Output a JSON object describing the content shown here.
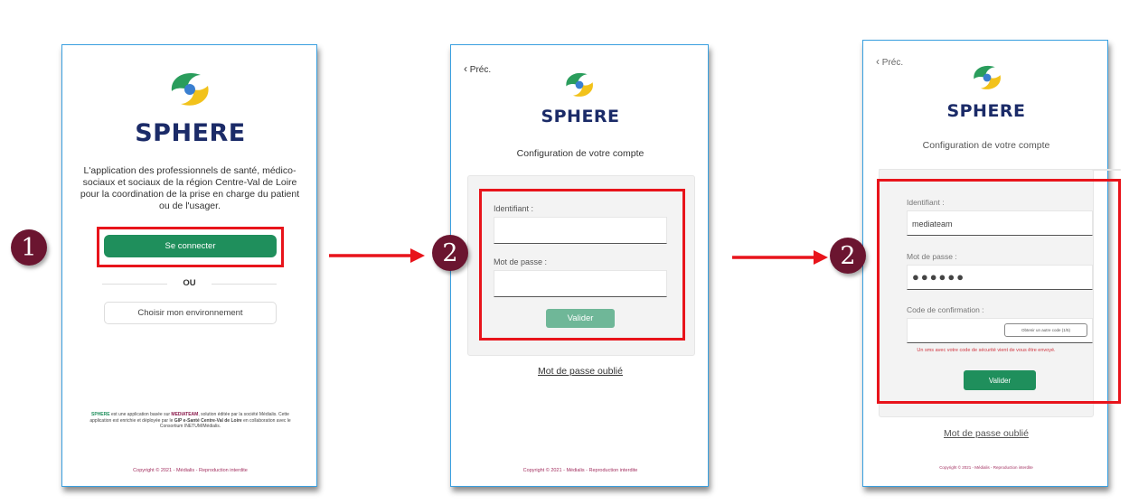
{
  "steps": {
    "one": "1",
    "two_a": "2",
    "two_b": "2"
  },
  "screen1": {
    "app_name": "SPHERE",
    "description": "L'application des professionnels de santé, médico-sociaux et sociaux de la région Centre-Val de Loire pour la coordination de la prise en charge du patient ou de l'usager.",
    "login_button": "Se connecter",
    "or_label": "OU",
    "env_button": "Choisir mon environnement",
    "footer": {
      "sphere": "SPHERE",
      "t1": " est une application basée sur ",
      "mediateam": "MEDIATEAM",
      "t2": ", solution éditée par la société Médialis. Cette application est enrichie et déployée par le ",
      "gip": "GIP e-Santé Centre-Val de Loire",
      "t3": " en collaboration avec le Consortium INETUM/Médialis."
    },
    "copyright": "Copyright © 2021 - Médialis - Reproduction interdite"
  },
  "screen2": {
    "back": "Préc.",
    "app_name": "SPHERE",
    "subtitle": "Configuration de votre compte",
    "identifier_label": "Identifiant :",
    "password_label": "Mot de passe :",
    "validate_button": "Valider",
    "forgot_password": "Mot de passe oublié",
    "copyright": "Copyright © 2021 - Médialis - Reproduction interdite"
  },
  "screen3": {
    "back": "Préc.",
    "app_name": "SPHERE",
    "subtitle": "Configuration de votre compte",
    "identifier_label": "Identifiant :",
    "identifier_value": "mediateam",
    "password_label": "Mot de passe :",
    "password_value": "●●●●●●",
    "code_label": "Code de confirmation :",
    "resend_code": "Obtenir un autre code (1/5)",
    "sms_message": "Un sms avec votre code de sécurité vient de vous être envoyé.",
    "validate_button": "Valider",
    "forgot_password": "Mot de passe oublié",
    "copyright": "Copyright © 2021 - Médialis - Reproduction interdite"
  },
  "colors": {
    "accent_green": "#1f8f5c",
    "brand_navy": "#1b2b68",
    "highlight_red": "#e8141b",
    "step_circle": "#6b1530",
    "frame_blue": "#3aa0e0"
  }
}
